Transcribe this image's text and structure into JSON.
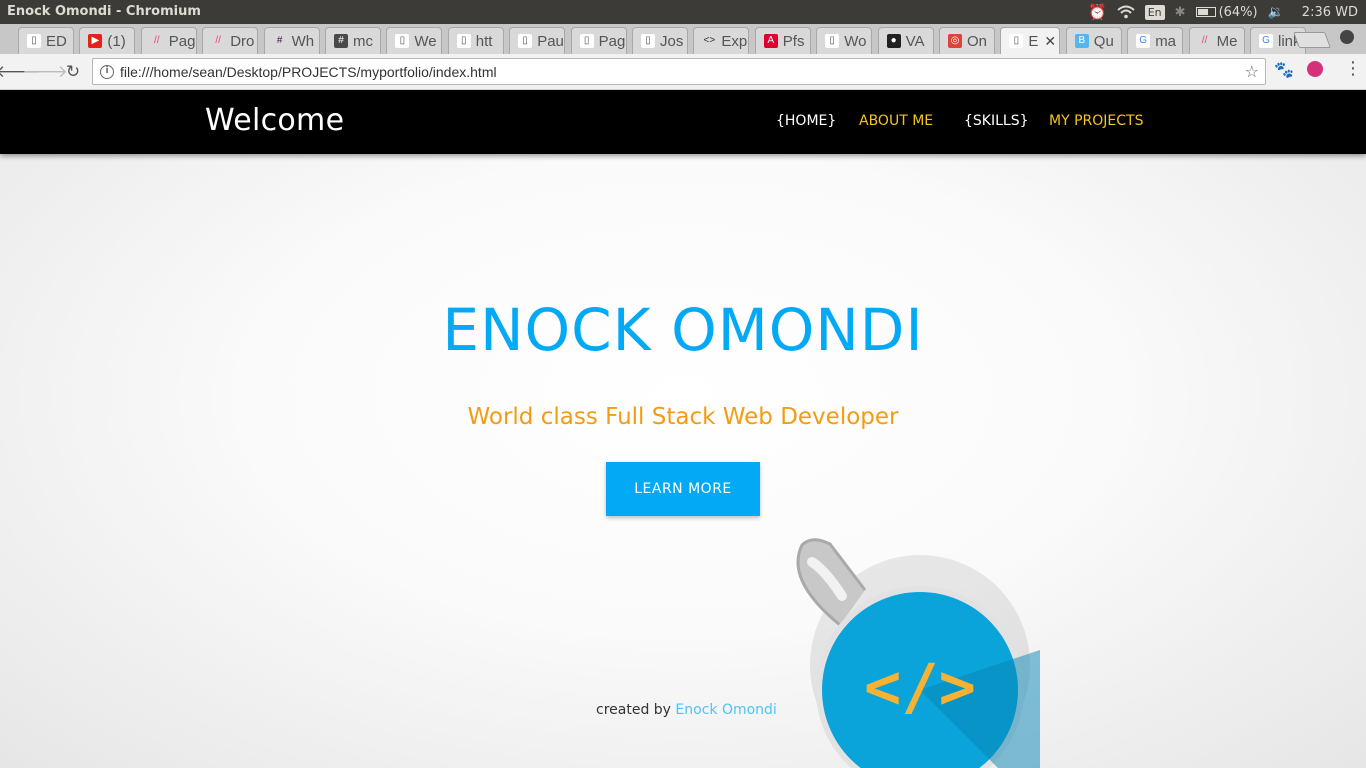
{
  "os": {
    "window_title": "Enock Omondi - Chromium",
    "keyboard": "En",
    "battery": "(64%)",
    "clock": "2:36 WD"
  },
  "tabs": [
    {
      "label": "ED",
      "favicon": "document-icon"
    },
    {
      "label": "(1)",
      "favicon": "youtube-icon"
    },
    {
      "label": "Pag",
      "favicon": "hackerrank-icon"
    },
    {
      "label": "Dro",
      "favicon": "hackerrank-icon"
    },
    {
      "label": "Wh",
      "favicon": "slack-icon"
    },
    {
      "label": "mc",
      "favicon": "hash-icon"
    },
    {
      "label": "We",
      "favicon": "document-icon"
    },
    {
      "label": "htt",
      "favicon": "document-icon"
    },
    {
      "label": "Pau",
      "favicon": "document-icon"
    },
    {
      "label": "Pag",
      "favicon": "document-icon"
    },
    {
      "label": "Jos",
      "favicon": "document-icon"
    },
    {
      "label": "Exp",
      "favicon": "code-icon"
    },
    {
      "label": "Pfs",
      "favicon": "angular-icon"
    },
    {
      "label": "Wo",
      "favicon": "document-icon"
    },
    {
      "label": "VA",
      "favicon": "github-icon"
    },
    {
      "label": "On",
      "favicon": "chrome-icon"
    },
    {
      "label": "E",
      "favicon": "document-icon"
    },
    {
      "label": "Qu",
      "favicon": "bootstrap-icon"
    },
    {
      "label": "ma",
      "favicon": "google-icon"
    },
    {
      "label": "Me",
      "favicon": "hackerrank-icon"
    },
    {
      "label": "link",
      "favicon": "google-icon"
    }
  ],
  "toolbar": {
    "url": "file:///home/sean/Desktop/PROJECTS/myportfolio/index.html"
  },
  "site": {
    "brand": "Welcome",
    "nav": [
      "{HOME}",
      "ABOUT ME",
      "{SKILLS}",
      "MY PROJECTS"
    ],
    "hero_name": "ENOCK OMONDI",
    "hero_subtitle": "World class Full Stack Web Developer",
    "cta_label": "LEARN MORE",
    "footer_prefix": "created by",
    "footer_link": "Enock Omondi",
    "mug_code": "</>"
  },
  "colors": {
    "accent_blue": "#03a9f4",
    "accent_orange": "#f39c12",
    "nav_yellow": "#f5c518",
    "navbar_bg": "#000000"
  }
}
